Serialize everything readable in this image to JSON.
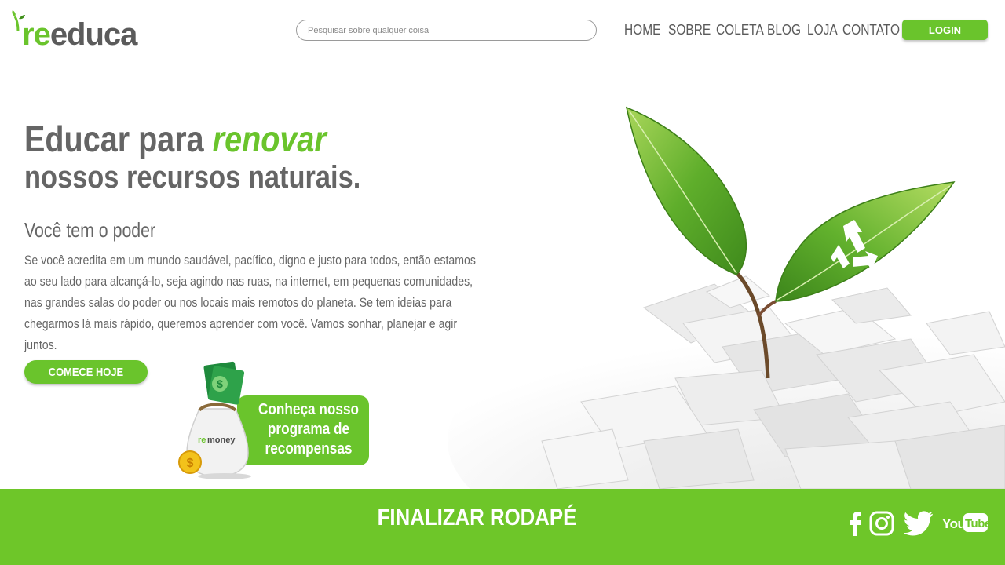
{
  "brand": {
    "logo_re": "re",
    "logo_rest": "educa"
  },
  "search": {
    "placeholder": "Pesquisar sobre qualquer coisa"
  },
  "nav": [
    "HOME",
    "SOBRE",
    "COLETA",
    "BLOG",
    "LOJA",
    "CONTATO"
  ],
  "login_label": "LOGIN",
  "hero": {
    "headline_part1": "Educar para ",
    "headline_highlight": "renovar",
    "headline_line2": "nossos recursos naturais.",
    "subheading": "Você tem o poder",
    "paragraph": "Se você acredita em um mundo saudável, pacífico, digno e justo para todos, então estamos ao seu lado para alcançá-lo, seja agindo nas ruas, na internet, em pequenas comunidades, nas grandes salas do poder ou nos locais mais remotos do planeta. Se tem ideias para chegarmos lá mais rápido, queremos aprender com você. Vamos sonhar, planejar e agir juntos.",
    "cta_label": "COMECE HOJE"
  },
  "rewards": {
    "bag_brand_re": "re",
    "bag_brand_rest": "money",
    "line1": "Conheça nosso",
    "line2": "programa de",
    "line3": "recompensas"
  },
  "footer": {
    "title": "FINALIZAR RODAPÉ",
    "youtube_you": "You",
    "youtube_tube": "Tube"
  },
  "colors": {
    "accent": "#6ac42c",
    "footer": "#6ec629",
    "text": "#656565"
  },
  "icons": [
    "sprout-icon",
    "recycle-icon",
    "money-bag-icon",
    "coin-icon",
    "facebook-icon",
    "instagram-icon",
    "twitter-icon",
    "youtube-icon"
  ]
}
